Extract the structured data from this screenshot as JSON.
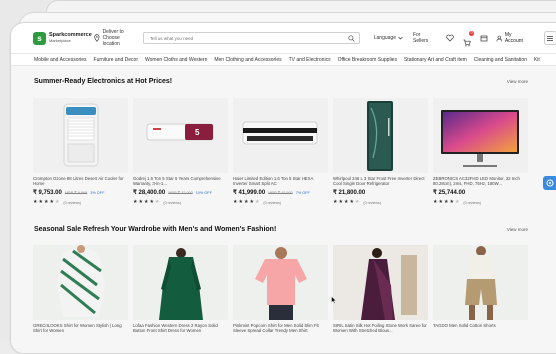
{
  "header": {
    "logo_name": "Sparkcommerce",
    "logo_sub": "Marketplace",
    "deliver_line1": "Deliver to",
    "deliver_line2": "Choose location",
    "search_placeholder": "Tell us what you need",
    "language_label": "Language",
    "sellers_label": "For Sellers",
    "cart_count": "0",
    "account_label": "My Account"
  },
  "categories": [
    "Mobile and Accessories",
    "Furniture and Decor",
    "Women Cloths and Western",
    "Men Clothing and Accessories",
    "TV and Electronics",
    "Office Breakroom Supplies",
    "Stationary Art and Craft item",
    "Cleaning and Sanitation",
    "Kit"
  ],
  "sections": [
    {
      "title": "Summer-Ready Electronics at Hot Prices!",
      "view_more": "View more",
      "products": [
        {
          "name": "Crompton Ozone 88 Litres Desert Air Cooler for Home",
          "price": "₹ 9,753.00",
          "mrp": "MRP ₹ 9,999",
          "off": "3% OFF",
          "rating": 4,
          "reviews": "(0 reviews)"
        },
        {
          "name": "Godrej 1.5 Ton 5 Star 5 Years Comprehensive Warranty, 3-in-1...",
          "price": "₹ 28,400.00",
          "mrp": "MRP ₹ 32,000",
          "off": "10% OFF",
          "rating": 4,
          "reviews": "(0 reviews)"
        },
        {
          "name": "Haier Limited Edition 1.6 Ton 5 Star HEXA Inverter Smart Split AC",
          "price": "₹ 41,999.00",
          "mrp": "MRP ₹ 45,500",
          "off": "7% OFF",
          "rating": 4,
          "reviews": "(0 reviews)"
        },
        {
          "name": "Whirlpool 246 L 3 Star Frost Free Inverter Direct Cool Single Door Refrigerator",
          "price": "₹ 21,800.00",
          "mrp": "",
          "off": "",
          "rating": 4,
          "reviews": "(0 reviews)"
        },
        {
          "name": "ZEBRONICS AC32FHD LED Monitor, 32 Inch 80.28cm), 2ms, FHD, 75Hz, 180W...",
          "price": "₹ 25,744.00",
          "mrp": "",
          "off": "",
          "rating": 4,
          "reviews": "(0 reviews)"
        }
      ]
    },
    {
      "title": "Seasonal Sale Refresh Your Wardrobe with Men's and Women's Fashion!",
      "view_more": "View more",
      "products": [
        {
          "name": "GRECIILOOKS Shirt for Women Stylish | Long Shirt for Women"
        },
        {
          "name": "Lofaa Fashion Western Dress 2 Rayon Solid Button Front Shirt Dress for Women"
        },
        {
          "name": "Pinkmint Popcorn Shirt for Men Solid Slim Fit Sleeve Spread Collar Trendy Men Shirt"
        },
        {
          "name": "SIRIL Satin Silk Hot Foiling Stone Work Saree for Women With Stretched Blous..."
        },
        {
          "name": "TAGDO Men Solid Cotton Shorts"
        }
      ]
    }
  ],
  "colors": {
    "brand": "#2e9b3e",
    "discount": "#2d6ec8",
    "widget": "#3a8be0"
  }
}
